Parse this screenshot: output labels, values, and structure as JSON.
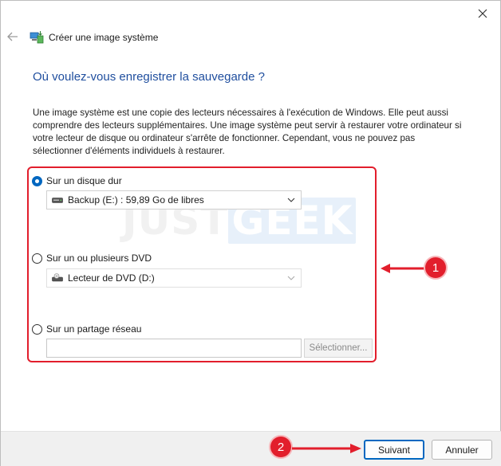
{
  "window": {
    "title": "Créer une image système",
    "heading": "Où voulez-vous enregistrer la sauvegarde ?",
    "description": "Une image système est une copie des lecteurs nécessaires à l'exécution de Windows. Elle peut aussi comprendre des lecteurs supplémentaires. Une image système peut servir à restaurer votre ordinateur si votre lecteur de disque ou ordinateur s'arrête de fonctionner. Cependant, vous ne pouvez pas sélectionner d'éléments individuels à restaurer."
  },
  "options": {
    "hard_disk": {
      "label": "Sur un disque dur",
      "checked": true,
      "selected_value": "Backup (E:) : 59,89 Go de libres"
    },
    "dvd": {
      "label": "Sur un ou plusieurs DVD",
      "checked": false,
      "selected_value": "Lecteur de DVD (D:)"
    },
    "network": {
      "label": "Sur un partage réseau",
      "checked": false,
      "input_value": "",
      "select_button": "Sélectionner..."
    }
  },
  "watermark": {
    "part1": "JUST",
    "part2": "GEEK"
  },
  "annotations": {
    "badge1": "1",
    "badge2": "2"
  },
  "buttons": {
    "next": "Suivant",
    "cancel": "Annuler"
  },
  "colors": {
    "accent": "#0067c0",
    "heading": "#1f4e9e",
    "annotation": "#e21e2c"
  }
}
